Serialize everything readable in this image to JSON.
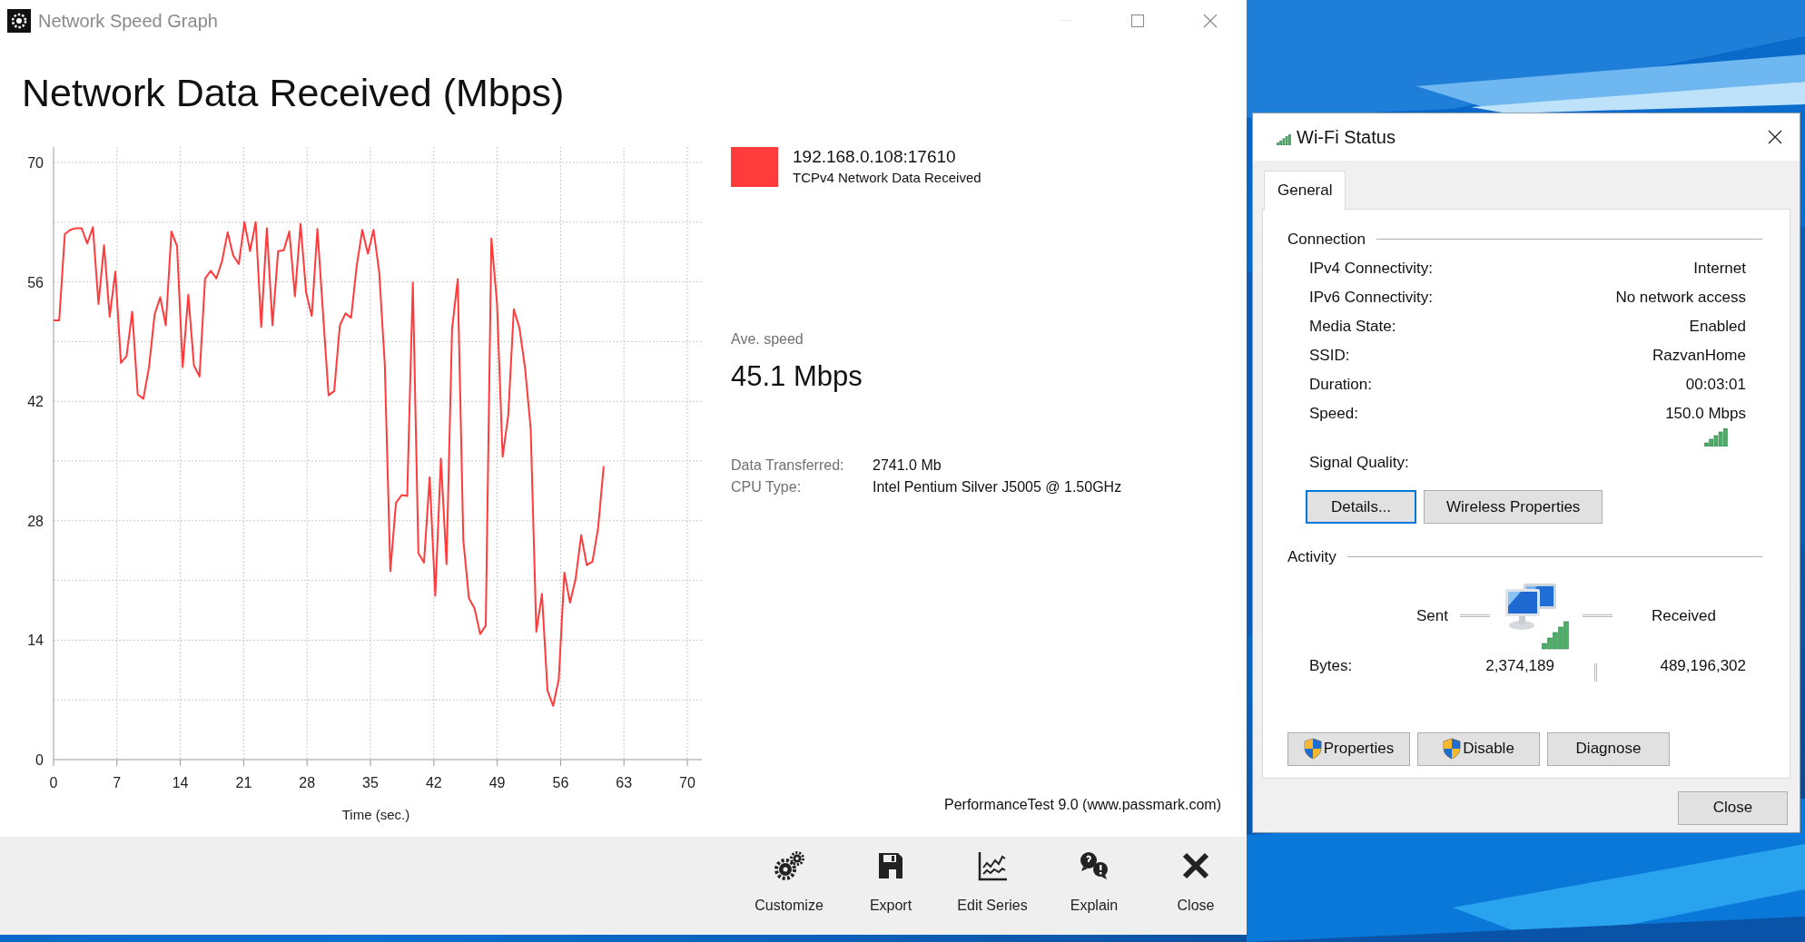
{
  "window": {
    "title": "Network Speed Graph"
  },
  "heading": "Network Data Received (Mbps)",
  "chart": {
    "chart_data": {
      "type": "line",
      "grid": true,
      "xlabel": "Time (sec.)",
      "xlim": [
        0,
        70
      ],
      "ylim": [
        0,
        70
      ],
      "xticks": [
        0,
        7,
        14,
        21,
        28,
        35,
        42,
        49,
        56,
        63,
        70
      ],
      "yticks": [
        0,
        14,
        28,
        42,
        56,
        70
      ],
      "x": [
        0,
        0.62,
        1.24,
        1.86,
        2.48,
        3.1,
        3.72,
        4.34,
        4.96,
        5.58,
        6.2,
        6.82,
        7.44,
        8.06,
        8.68,
        9.3,
        9.92,
        10.54,
        11.16,
        11.78,
        12.4,
        13.02,
        13.64,
        14.26,
        14.88,
        15.5,
        16.12,
        16.74,
        17.36,
        17.98,
        18.6,
        19.22,
        19.84,
        20.46,
        21.08,
        21.7,
        22.32,
        22.94,
        23.56,
        24.18,
        24.8,
        25.42,
        26.04,
        26.66,
        27.28,
        27.9,
        28.52,
        29.14,
        29.76,
        30.38,
        31,
        31.62,
        32.24,
        32.86,
        33.48,
        34.1,
        34.72,
        35.34,
        35.96,
        36.58,
        37.2,
        37.82,
        38.44,
        39.06,
        39.68,
        40.3,
        40.92,
        41.54,
        42.16,
        42.78,
        43.4,
        44.02,
        44.64,
        45.26,
        45.88,
        46.5,
        47.12,
        47.74,
        48.36,
        48.98,
        49.6,
        50.22,
        50.84,
        51.46,
        52.08,
        52.7,
        53.32,
        53.94,
        54.56,
        55.18,
        55.8,
        56.42,
        57.04,
        57.66,
        58.28,
        58.9,
        59.52,
        60.14,
        60.76
      ],
      "series": [
        {
          "name": "192.168.0.108:17610",
          "color": "#ff3b3b",
          "values": [
            51.5,
            51.5,
            61.6,
            62.1,
            62.3,
            62.3,
            60.5,
            62.4,
            53.4,
            60.3,
            51.9,
            57.2,
            46.5,
            47.3,
            52.5,
            42.8,
            42.3,
            46.0,
            52.2,
            54.2,
            50.9,
            61.9,
            60.2,
            46.0,
            54.5,
            46.2,
            44.9,
            56.4,
            57.3,
            56.4,
            58.4,
            61.8,
            59.1,
            58.1,
            63.0,
            59.6,
            63.0,
            50.7,
            62.3,
            50.9,
            59.6,
            59.7,
            61.9,
            54.3,
            62.8,
            54.7,
            52.0,
            62.2,
            52.4,
            42.7,
            43.2,
            50.9,
            52.3,
            51.8,
            57.8,
            62.1,
            59.3,
            62.1,
            57.2,
            46.3,
            22.1,
            30.1,
            31.0,
            30.9,
            55.9,
            24.2,
            23.1,
            33.1,
            19.2,
            35.3,
            22.9,
            50.5,
            56.3,
            25.7,
            18.9,
            17.7,
            14.7,
            15.7,
            61.1,
            53.5,
            35.5,
            40.4,
            52.8,
            50.6,
            45.9,
            38.8,
            15.0,
            19.4,
            8.1,
            6.3,
            9.4,
            21.9,
            18.4,
            21.2,
            26.3,
            22.8,
            23.2,
            27.1,
            34.4
          ]
        }
      ]
    }
  },
  "legend": [
    {
      "sublabel": "TCPv4 Network Data Received"
    }
  ],
  "average": {
    "label": "Ave. speed",
    "value": "45.1 Mbps"
  },
  "details": [
    {
      "label": "Data Transferred:",
      "value": "2741.0 Mb"
    },
    {
      "label": "CPU Type:",
      "value": "Intel Pentium Silver J5005 @ 1.50GHz"
    }
  ],
  "credit": "PerformanceTest 9.0 (www.passmark.com)",
  "toolbar": [
    {
      "kind": "gears",
      "label": "Customize"
    },
    {
      "kind": "save",
      "label": "Export"
    },
    {
      "kind": "chart",
      "label": "Edit Series"
    },
    {
      "kind": "help",
      "label": "Explain"
    },
    {
      "kind": "close",
      "label": "Close"
    }
  ],
  "wifi_dialog": {
    "title": "Wi-Fi Status",
    "tabs": [
      {
        "label": "General",
        "selected": true
      }
    ],
    "connection": {
      "heading": "Connection",
      "rows": [
        {
          "label": "IPv4 Connectivity:",
          "value": "Internet"
        },
        {
          "label": "IPv6 Connectivity:",
          "value": "No network access"
        },
        {
          "label": "Media State:",
          "value": "Enabled"
        },
        {
          "label": "SSID:",
          "value": "RazvanHome"
        },
        {
          "label": "Duration:",
          "value": "00:03:01"
        },
        {
          "label": "Speed:",
          "value": "150.0 Mbps"
        }
      ],
      "signal_label": "Signal Quality:"
    },
    "connection_buttons": [
      {
        "label": "Details...",
        "focused": true
      },
      {
        "label": "Wireless Properties",
        "focused": false
      }
    ],
    "activity": {
      "heading": "Activity",
      "sent_label": "Sent",
      "received_label": "Received",
      "bytes_label": "Bytes:",
      "sent": "2,374,189",
      "received": "489,196,302"
    },
    "action_buttons": [
      {
        "label": "Properties",
        "shield": true
      },
      {
        "label": "Disable",
        "shield": true
      },
      {
        "label": "Diagnose",
        "shield": false
      }
    ],
    "close_button": "Close"
  }
}
